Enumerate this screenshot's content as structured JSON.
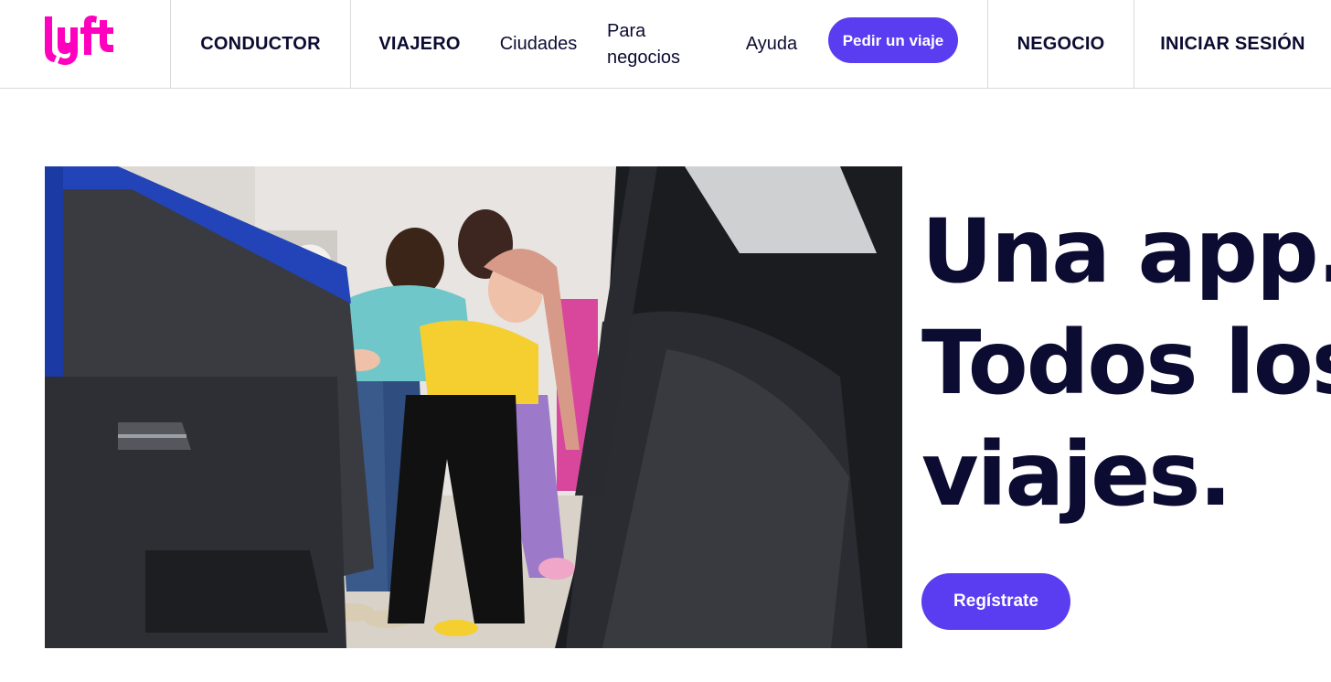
{
  "brand": {
    "logo_text": "lyft",
    "color": "#ff00bf"
  },
  "nav": {
    "conductor": "CONDUCTOR",
    "viajero": "VIAJERO",
    "ciudades": "Ciudades",
    "para_negocios": "Para negocios",
    "ayuda": "Ayuda",
    "pedir_viaje": "Pedir un viaje",
    "negocio": "NEGOCIO",
    "iniciar_sesion": "INICIAR SESIÓN"
  },
  "hero": {
    "headline_lines": [
      "Una app.",
      "Todos los",
      "viajes."
    ],
    "cta_label": "Regístrate",
    "accent_color": "#5a3df0",
    "text_color": "#0c0b31"
  }
}
